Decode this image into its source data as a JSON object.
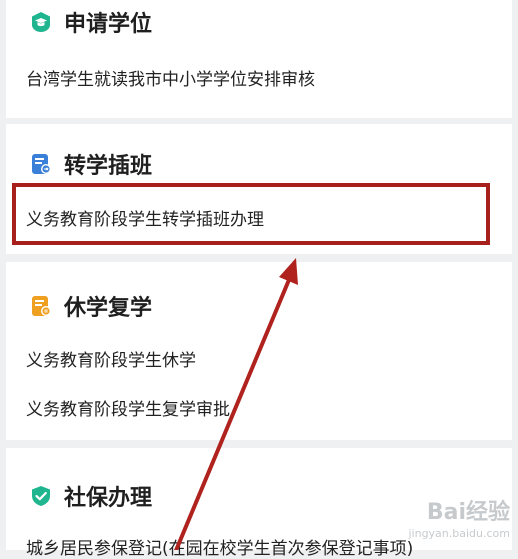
{
  "sections": [
    {
      "title": "申请学位",
      "icon": "graduation-cap-icon",
      "items": [
        "台湾学生就读我市中小学学位安排审核"
      ]
    },
    {
      "title": "转学插班",
      "icon": "transfer-document-icon",
      "items": [
        "义务教育阶段学生转学插班办理"
      ]
    },
    {
      "title": "休学复学",
      "icon": "suspension-document-icon",
      "items": [
        "义务教育阶段学生休学",
        "义务教育阶段学生复学审批"
      ]
    },
    {
      "title": "社保办理",
      "icon": "shield-check-icon",
      "items": [
        "城乡居民参保登记(在园在校学生首次参保登记事项)"
      ]
    }
  ],
  "watermark": {
    "logo": "Bai经验",
    "sub": "jingyan.baidu.com"
  },
  "colors": {
    "green": "#1fb58f",
    "blue": "#3a7fd8",
    "amber": "#f0a020",
    "highlight": "#a8201c"
  }
}
